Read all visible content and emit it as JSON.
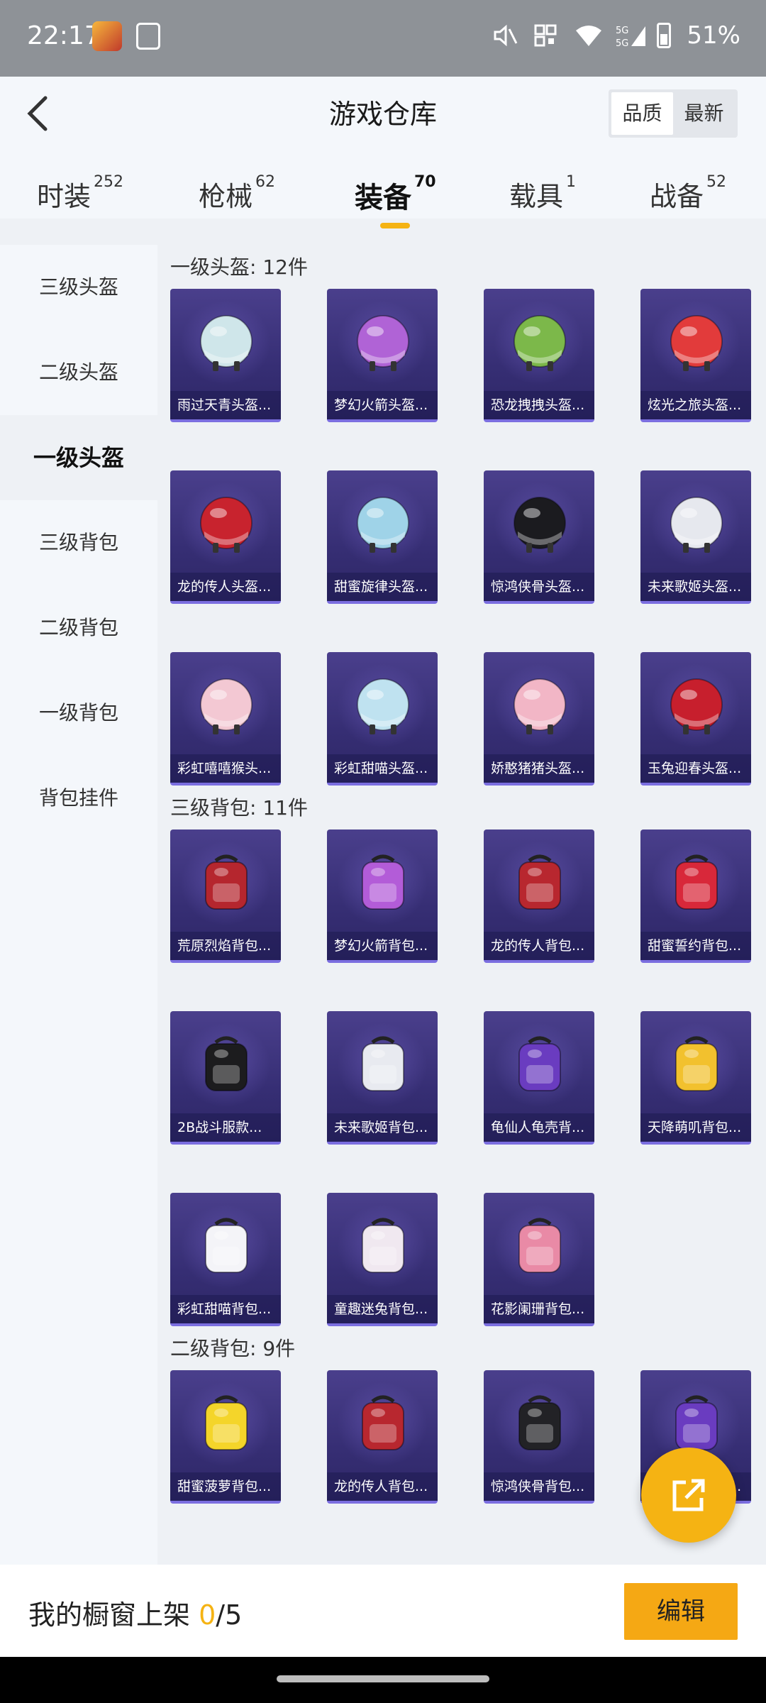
{
  "status": {
    "time": "22:17",
    "battery": "51%",
    "network": "5G"
  },
  "header": {
    "title": "游戏仓库",
    "sort_quality": "品质",
    "sort_latest": "最新"
  },
  "tabs": [
    {
      "label": "时装",
      "count": "252"
    },
    {
      "label": "枪械",
      "count": "62"
    },
    {
      "label": "装备",
      "count": "70"
    },
    {
      "label": "载具",
      "count": "1"
    },
    {
      "label": "战备",
      "count": "52"
    }
  ],
  "sidebar": [
    {
      "label": "三级头盔"
    },
    {
      "label": "二级头盔"
    },
    {
      "label": "一级头盔"
    },
    {
      "label": "三级背包"
    },
    {
      "label": "二级背包"
    },
    {
      "label": "一级背包"
    },
    {
      "label": "背包挂件"
    }
  ],
  "sections": [
    {
      "title": "一级头盔: 12件",
      "items": [
        {
          "label": "雨过天青头盔...",
          "kind": "helmet",
          "color": "#cfe6ea"
        },
        {
          "label": "梦幻火箭头盔...",
          "kind": "helmet",
          "color": "#b063d6"
        },
        {
          "label": "恐龙拽拽头盔...",
          "kind": "helmet",
          "color": "#7cb84a"
        },
        {
          "label": "炫光之旅头盔...",
          "kind": "helmet",
          "color": "#e23b3b"
        },
        {
          "label": "龙的传人头盔...",
          "kind": "helmet",
          "color": "#c8232e"
        },
        {
          "label": "甜蜜旋律头盔...",
          "kind": "helmet",
          "color": "#9fd3e8"
        },
        {
          "label": "惊鸿侠骨头盔...",
          "kind": "helmet",
          "color": "#1b1b1f"
        },
        {
          "label": "未来歌姬头盔...",
          "kind": "helmet",
          "color": "#e6e8ee"
        },
        {
          "label": "彩虹嘻嘻猴头...",
          "kind": "helmet",
          "color": "#f3c8d3"
        },
        {
          "label": "彩虹甜喵头盔...",
          "kind": "helmet",
          "color": "#bfe2f0"
        },
        {
          "label": "娇憨猪猪头盔...",
          "kind": "helmet",
          "color": "#f2b6c6"
        },
        {
          "label": "玉兔迎春头盔...",
          "kind": "helmet",
          "color": "#c71f2d"
        }
      ]
    },
    {
      "title": "三级背包: 11件",
      "items": [
        {
          "label": "荒原烈焰背包...",
          "kind": "backpack",
          "color": "#b5262e"
        },
        {
          "label": "梦幻火箭背包...",
          "kind": "backpack",
          "color": "#b35cd8"
        },
        {
          "label": "龙的传人背包...",
          "kind": "backpack",
          "color": "#b8272f"
        },
        {
          "label": "甜蜜誓约背包...",
          "kind": "backpack",
          "color": "#d8283a"
        },
        {
          "label": "2B战斗服款...",
          "kind": "backpack",
          "color": "#1c1c1e"
        },
        {
          "label": "未来歌姬背包...",
          "kind": "backpack",
          "color": "#e8eaf0"
        },
        {
          "label": "龟仙人龟壳背...",
          "kind": "backpack",
          "color": "#6a3cc0"
        },
        {
          "label": "天降萌叽背包...",
          "kind": "backpack",
          "color": "#f2c12e"
        },
        {
          "label": "彩虹甜喵背包...",
          "kind": "backpack",
          "color": "#f4f4f8"
        },
        {
          "label": "童趣迷兔背包...",
          "kind": "backpack",
          "color": "#f0e8f0"
        },
        {
          "label": "花影阑珊背包...",
          "kind": "backpack",
          "color": "#e98aa6"
        }
      ]
    },
    {
      "title": "二级背包: 9件",
      "items": [
        {
          "label": "甜蜜菠萝背包...",
          "kind": "backpack",
          "color": "#f4d52a"
        },
        {
          "label": "龙的传人背包...",
          "kind": "backpack",
          "color": "#b8272f"
        },
        {
          "label": "惊鸿侠骨背包...",
          "kind": "backpack",
          "color": "#222226"
        },
        {
          "label": "龟仙人龟壳背...",
          "kind": "backpack",
          "color": "#6a3cc0"
        }
      ]
    }
  ],
  "bottom": {
    "showcase_label": "我的橱窗上架",
    "showcase_count": "0",
    "showcase_max": "/5",
    "edit_label": "编辑"
  }
}
